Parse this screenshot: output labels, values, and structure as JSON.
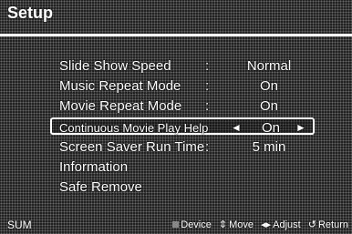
{
  "title": "Setup",
  "menu": [
    {
      "label": "Slide Show Speed",
      "colon": ":",
      "value": "Normal"
    },
    {
      "label": "Music Repeat Mode",
      "colon": ":",
      "value": "On"
    },
    {
      "label": "Movie Repeat Mode",
      "colon": ":",
      "value": "On"
    },
    {
      "label": "Continuous Movie Play Help",
      "value": "On",
      "left_arrow": "◄",
      "right_arrow": "►"
    },
    {
      "label": "Screen Saver Run Time",
      "colon": ":",
      "value": "5 min"
    },
    {
      "label": "Information"
    },
    {
      "label": "Safe Remove"
    }
  ],
  "footer": {
    "mode": "SUM",
    "device_icon": "square-icon",
    "device": "Device",
    "move_icon": "updown-arrow-icon",
    "move_glyph": "⇕",
    "move": "Move",
    "adjust_icon": "leftright-arrow-icon",
    "adjust_glyph": "◂▸",
    "adjust": "Adjust",
    "return_icon": "return-arrow-icon",
    "return_glyph": "↺",
    "return": "Return"
  }
}
